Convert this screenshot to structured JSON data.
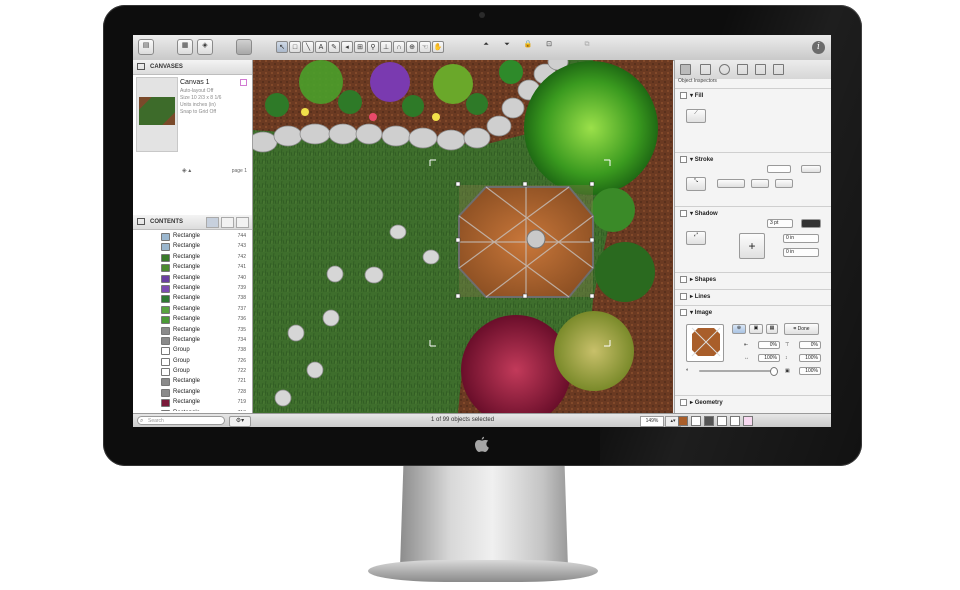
{
  "toolbar": {
    "tools": [
      "selection",
      "shape",
      "line",
      "text",
      "pen",
      "magnet",
      "diagram",
      "style",
      "stamp",
      "zoom",
      "hand",
      "browse"
    ]
  },
  "sidebar": {
    "canvases_header": "CANVASES",
    "canvas": {
      "name": "Canvas 1",
      "meta": [
        "Auto-layout Off",
        "Size 10 2/3 x 8 1/6",
        "Units inches (in)",
        "Snap to Grid Off"
      ],
      "page_label": "page 1"
    },
    "contents_header": "CONTENTS",
    "rows": [
      {
        "label": "Rectangle",
        "num": "744",
        "color": "#9bb7cf"
      },
      {
        "label": "Rectangle",
        "num": "743",
        "color": "#9bb7cf"
      },
      {
        "label": "Rectangle",
        "num": "742",
        "color": "#3a7a2a"
      },
      {
        "label": "Rectangle",
        "num": "741",
        "color": "#4c8a2f"
      },
      {
        "label": "Rectangle",
        "num": "740",
        "color": "#6b3fa0"
      },
      {
        "label": "Rectangle",
        "num": "739",
        "color": "#7d4bb0"
      },
      {
        "label": "Rectangle",
        "num": "738",
        "color": "#2f7a32"
      },
      {
        "label": "Rectangle",
        "num": "737",
        "color": "#58a33f"
      },
      {
        "label": "Rectangle",
        "num": "736",
        "color": "#4a9a36"
      },
      {
        "label": "Rectangle",
        "num": "735",
        "color": "#8a8a8a"
      },
      {
        "label": "Rectangle",
        "num": "734",
        "color": "#8a8a8a"
      },
      {
        "label": "Group",
        "num": "738",
        "color": "#ffffff"
      },
      {
        "label": "Group",
        "num": "726",
        "color": "#ffffff"
      },
      {
        "label": "Group",
        "num": "722",
        "color": "#ffffff"
      },
      {
        "label": "Rectangle",
        "num": "721",
        "color": "#8a8a8a"
      },
      {
        "label": "Rectangle",
        "num": "728",
        "color": "#8a8a8a"
      },
      {
        "label": "Rectangle",
        "num": "719",
        "color": "#7a1a3a"
      },
      {
        "label": "Rectangle",
        "num": "718",
        "color": "#3c8a2a"
      },
      {
        "label": "Rectangle",
        "num": "717",
        "color": "#8a8a8a"
      },
      {
        "label": "Rectangle",
        "num": "",
        "color": "#8a8a8a"
      }
    ]
  },
  "statusbar": {
    "search_placeholder": "Search",
    "status_text": "1 of 99 objects selected",
    "zoom": "149%"
  },
  "inspector": {
    "title": "Object Inspectors",
    "fill": "Fill",
    "stroke": "Stroke",
    "shadow": "Shadow",
    "shadow_size": "3 pt",
    "shadow_offset_x": "0 in",
    "shadow_offset_y": "0 in",
    "shapes": "Shapes",
    "lines": "Lines",
    "image": "Image",
    "done": "Done",
    "crop_left": "0%",
    "crop_top": "0%",
    "scale_x": "100%",
    "scale_y": "100%",
    "opacity": "100%",
    "geometry": "Geometry"
  }
}
